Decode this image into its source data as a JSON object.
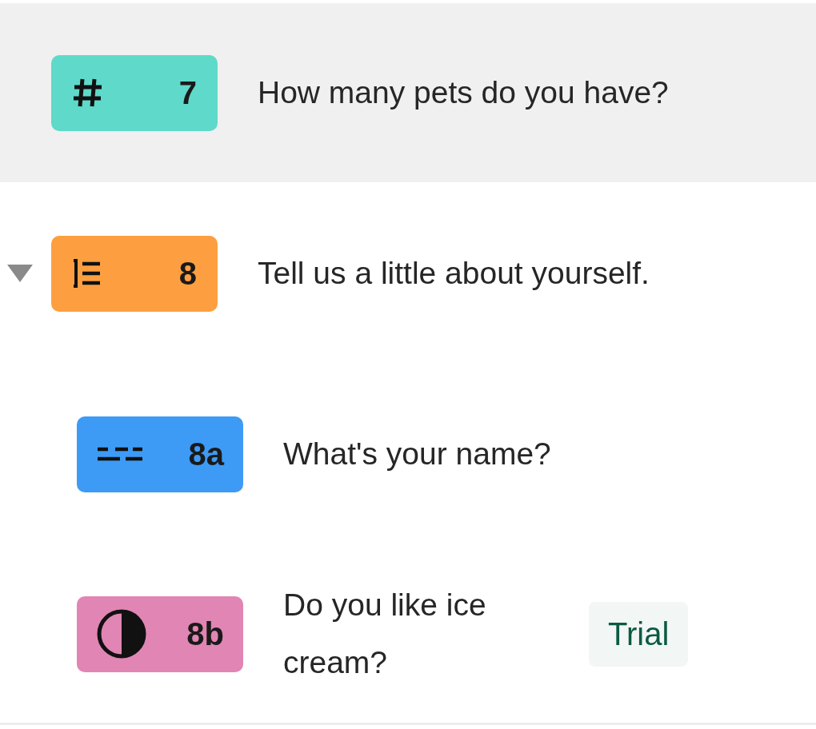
{
  "questions": [
    {
      "kind": "number",
      "number": "7",
      "color": "#5fd9c9",
      "title": "How many pets do you have?",
      "selected": true
    },
    {
      "kind": "long_text",
      "number": "8",
      "color": "#fd9f40",
      "title": "Tell us a little about yourself.",
      "selected": false,
      "expanded": true,
      "children": [
        {
          "kind": "short_text",
          "number": "8a",
          "color": "#3d9bf6",
          "title": "What's your name?",
          "selected": false
        },
        {
          "kind": "contrast",
          "number": "8b",
          "color": "#e185b4",
          "title": "Do you like ice cream?",
          "selected": false,
          "tag": "Trial"
        }
      ]
    }
  ]
}
